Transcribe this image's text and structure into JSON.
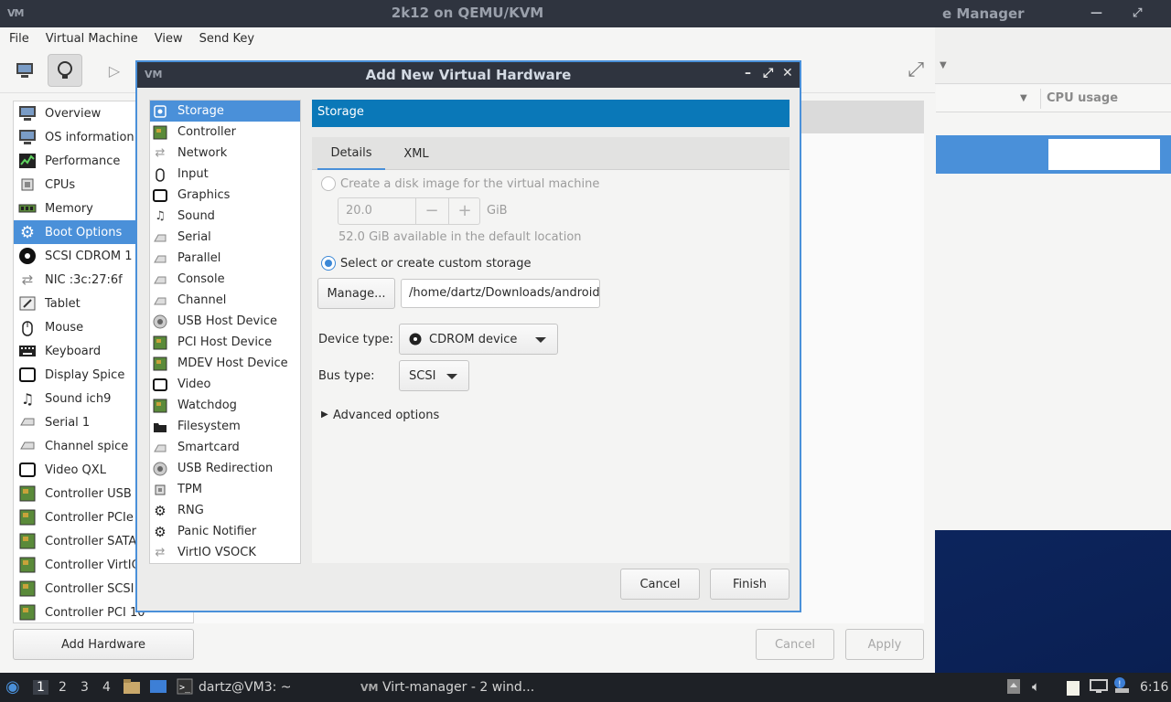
{
  "vmm_window": {
    "title_partial": "e Manager",
    "column_header": "CPU usage"
  },
  "vm_window": {
    "title": "2k12 on QEMU/KVM",
    "menu": [
      "File",
      "Virtual Machine",
      "View",
      "Send Key"
    ],
    "hardware_list": [
      {
        "label": "Overview",
        "icon": "monitor-icon"
      },
      {
        "label": "OS information",
        "icon": "monitor-icon"
      },
      {
        "label": "Performance",
        "icon": "performance-icon"
      },
      {
        "label": "CPUs",
        "icon": "cpu-icon"
      },
      {
        "label": "Memory",
        "icon": "memory-icon"
      },
      {
        "label": "Boot Options",
        "icon": "gear-icon"
      },
      {
        "label": "SCSI CDROM 1",
        "icon": "cdrom-icon"
      },
      {
        "label": "NIC :3c:27:6f",
        "icon": "network-icon"
      },
      {
        "label": "Tablet",
        "icon": "tablet-icon"
      },
      {
        "label": "Mouse",
        "icon": "mouse-icon"
      },
      {
        "label": "Keyboard",
        "icon": "keyboard-icon"
      },
      {
        "label": "Display Spice",
        "icon": "display-icon"
      },
      {
        "label": "Sound ich9",
        "icon": "sound-icon"
      },
      {
        "label": "Serial 1",
        "icon": "serial-icon"
      },
      {
        "label": "Channel spice",
        "icon": "serial-icon"
      },
      {
        "label": "Video QXL",
        "icon": "display-icon"
      },
      {
        "label": "Controller USB",
        "icon": "controller-icon"
      },
      {
        "label": "Controller PCIe",
        "icon": "controller-icon"
      },
      {
        "label": "Controller SATA",
        "icon": "controller-icon"
      },
      {
        "label": "Controller VirtIO",
        "icon": "controller-icon"
      },
      {
        "label": "Controller SCSI",
        "icon": "controller-icon"
      },
      {
        "label": "Controller PCI 10",
        "icon": "controller-icon"
      }
    ],
    "add_hardware": "Add Hardware",
    "cancel": "Cancel",
    "apply": "Apply"
  },
  "dialog": {
    "title": "Add New Virtual Hardware",
    "device_types": [
      {
        "label": "Storage",
        "icon": "storage-icon"
      },
      {
        "label": "Controller",
        "icon": "controller-icon"
      },
      {
        "label": "Network",
        "icon": "network-icon"
      },
      {
        "label": "Input",
        "icon": "mouse-icon"
      },
      {
        "label": "Graphics",
        "icon": "display-icon"
      },
      {
        "label": "Sound",
        "icon": "sound-icon"
      },
      {
        "label": "Serial",
        "icon": "serial-icon"
      },
      {
        "label": "Parallel",
        "icon": "serial-icon"
      },
      {
        "label": "Console",
        "icon": "serial-icon"
      },
      {
        "label": "Channel",
        "icon": "serial-icon"
      },
      {
        "label": "USB Host Device",
        "icon": "usb-icon"
      },
      {
        "label": "PCI Host Device",
        "icon": "controller-icon"
      },
      {
        "label": "MDEV Host Device",
        "icon": "controller-icon"
      },
      {
        "label": "Video",
        "icon": "display-icon"
      },
      {
        "label": "Watchdog",
        "icon": "controller-icon"
      },
      {
        "label": "Filesystem",
        "icon": "folder-icon"
      },
      {
        "label": "Smartcard",
        "icon": "serial-icon"
      },
      {
        "label": "USB Redirection",
        "icon": "usb-icon"
      },
      {
        "label": "TPM",
        "icon": "cpu-icon"
      },
      {
        "label": "RNG",
        "icon": "gear-icon"
      },
      {
        "label": "Panic Notifier",
        "icon": "gear-icon"
      },
      {
        "label": "VirtIO VSOCK",
        "icon": "network-icon"
      }
    ],
    "pane_header": "Storage",
    "tabs": [
      "Details",
      "XML"
    ],
    "create_disk_label": "Create a disk image for the virtual machine",
    "disk_size": "20.0",
    "disk_unit": "GiB",
    "available_text": "52.0 GiB available in the default location",
    "custom_storage_label": "Select or create custom storage",
    "manage_button": "Manage...",
    "storage_path": "/home/dartz/Downloads/android",
    "device_type_label": "Device type:",
    "device_type_value": "CDROM device",
    "bus_type_label": "Bus type:",
    "bus_type_value": "SCSI",
    "advanced_options": "Advanced options",
    "cancel": "Cancel",
    "finish": "Finish"
  },
  "taskbar": {
    "workspaces": [
      "1",
      "2",
      "3",
      "4"
    ],
    "terminal_task": "dartz@VM3: ~",
    "virt_task": "Virt-manager - 2 wind...",
    "clock": "6:16"
  }
}
